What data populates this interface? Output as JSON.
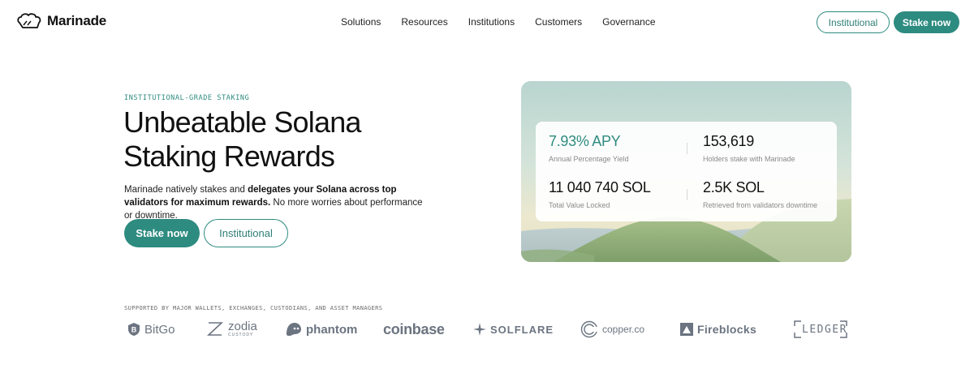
{
  "header": {
    "brand": "Marinade",
    "nav": [
      "Solutions",
      "Resources",
      "Institutions",
      "Customers",
      "Governance"
    ],
    "institutional_label": "Institutional",
    "stake_label": "Stake now"
  },
  "hero": {
    "eyebrow": "INSTITUTIONAL-GRADE STAKING",
    "headline_line1": "Unbeatable Solana",
    "headline_line2": "Staking Rewards",
    "sub_part1": "Marinade natively stakes and ",
    "sub_bold1": "delegates your Solana across top validators for maximum rewards.",
    "sub_part2": " No more worries about performance or downtime.",
    "cta_stake": "Stake now",
    "cta_institutional": "Institutional"
  },
  "stats": {
    "apy_value": "7.93% APY",
    "apy_label": "Annual Percentage Yield",
    "holders_value": "153,619",
    "holders_label": "Holders stake with Marinade",
    "tvl_value": "11 040 740 SOL",
    "tvl_label": "Total Value Locked",
    "retrieved_value": "2.5K SOL",
    "retrieved_label": "Retrieved from validators downtime"
  },
  "partners": {
    "caption": "SUPPORTED BY MAJOR WALLETS, EXCHANGES, CUSTODIANS, AND ASSET MANAGERS",
    "bitgo": "BitGo",
    "zodia": "zodia",
    "zodia_sub": "CUSTODY",
    "phantom": "phantom",
    "coinbase": "coinbase",
    "solflare": "SOLFLARE",
    "copper": "copper.co",
    "fireblocks": "Fireblocks",
    "ledger": "LEDGER"
  },
  "colors": {
    "accent": "#2e8b80",
    "logo_gray": "#6b7480"
  }
}
